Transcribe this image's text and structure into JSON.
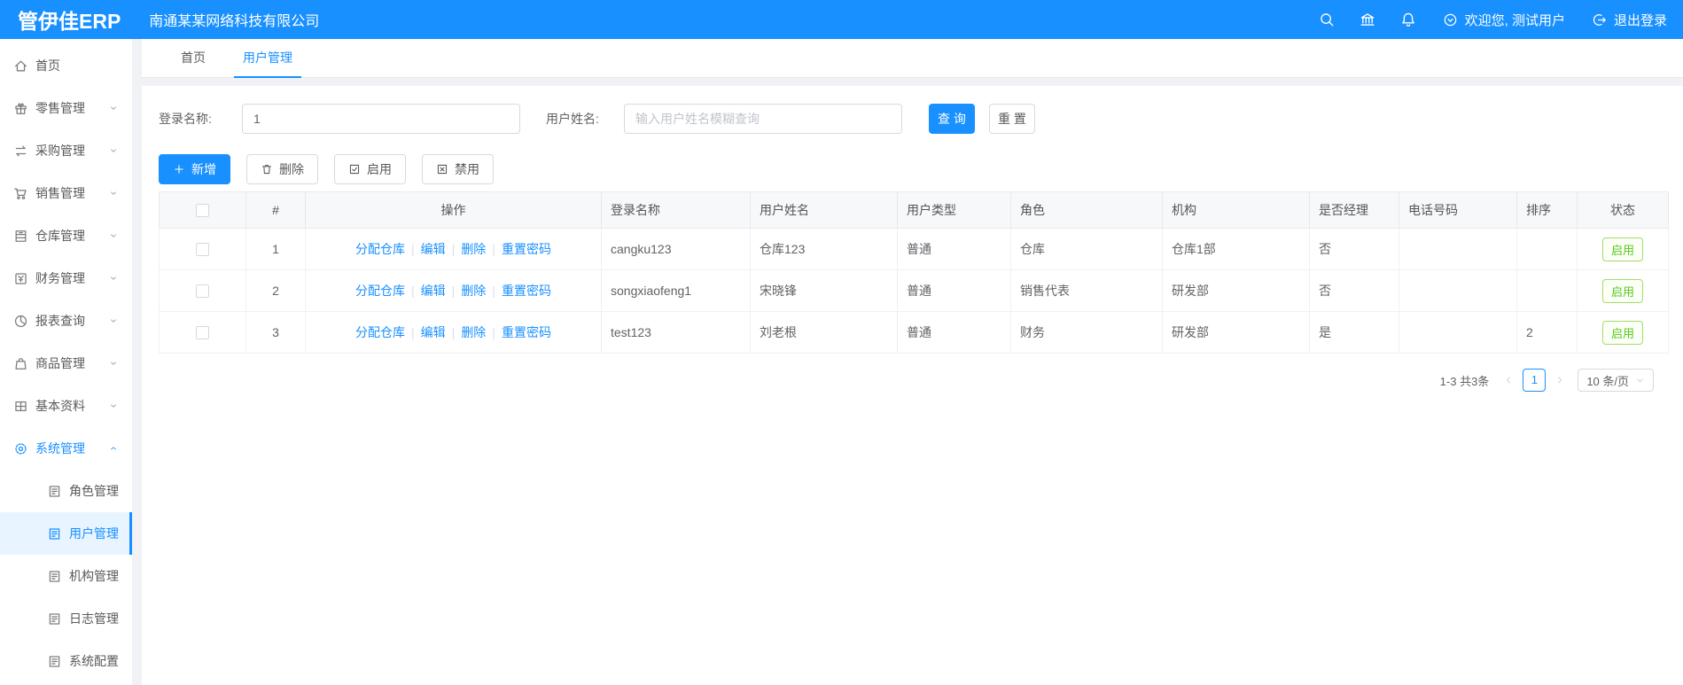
{
  "colors": {
    "accent": "#1890ff",
    "status_green": "#54c71c"
  },
  "header": {
    "logo": "管伊佳ERP",
    "company": "南通某某网络科技有限公司",
    "icon_buttons": [
      {
        "key": "search",
        "icon": "search-icon"
      },
      {
        "key": "bank",
        "icon": "bank-icon"
      },
      {
        "key": "notification",
        "icon": "bell-icon"
      }
    ],
    "welcome": "欢迎您, 测试用户",
    "logout": "退出登录"
  },
  "sidebar": {
    "items": [
      {
        "key": "home",
        "label": "首页",
        "icon": "home-icon",
        "expandable": false
      },
      {
        "key": "retail-management",
        "label": "零售管理",
        "icon": "gift-icon",
        "expandable": true
      },
      {
        "key": "purchase-management",
        "label": "采购管理",
        "icon": "swap-icon",
        "expandable": true
      },
      {
        "key": "sales-management",
        "label": "销售管理",
        "icon": "cart-icon",
        "expandable": true
      },
      {
        "key": "warehouse-management",
        "label": "仓库管理",
        "icon": "storage-icon",
        "expandable": true
      },
      {
        "key": "finance-management",
        "label": "财务管理",
        "icon": "finance-icon",
        "expandable": true
      },
      {
        "key": "report-query",
        "label": "报表查询",
        "icon": "pie-chart-icon",
        "expandable": true
      },
      {
        "key": "product-management",
        "label": "商品管理",
        "icon": "bag-icon",
        "expandable": true
      },
      {
        "key": "basic-data",
        "label": "基本资料",
        "icon": "grid-icon",
        "expandable": true
      },
      {
        "key": "system-management",
        "label": "系统管理",
        "icon": "gear-icon",
        "expandable": true,
        "expanded": true,
        "active": true,
        "children": [
          {
            "key": "role-management",
            "label": "角色管理",
            "icon": "doc-icon"
          },
          {
            "key": "user-management",
            "label": "用户管理",
            "icon": "doc-icon",
            "active": true
          },
          {
            "key": "org-management",
            "label": "机构管理",
            "icon": "doc-icon"
          },
          {
            "key": "log-management",
            "label": "日志管理",
            "icon": "doc-icon"
          },
          {
            "key": "system-config",
            "label": "系统配置",
            "icon": "doc-icon"
          }
        ]
      }
    ]
  },
  "tabs": [
    {
      "key": "home",
      "label": "首页",
      "active": false
    },
    {
      "key": "user-management",
      "label": "用户管理",
      "active": true
    }
  ],
  "search": {
    "login_label": "登录名称:",
    "login_value": "1",
    "name_label": "用户姓名:",
    "name_placeholder": "输入用户姓名模糊查询",
    "query_button": "查 询",
    "reset_button": "重 置"
  },
  "toolbar": {
    "buttons": [
      {
        "key": "add",
        "label": "新增",
        "icon": "plus-icon",
        "primary": true
      },
      {
        "key": "delete",
        "label": "删除",
        "icon": "trash-icon",
        "primary": false
      },
      {
        "key": "enable",
        "label": "启用",
        "icon": "check-square-icon",
        "primary": false
      },
      {
        "key": "disable",
        "label": "禁用",
        "icon": "x-square-icon",
        "primary": false
      }
    ]
  },
  "table": {
    "columns": [
      "#",
      "操作",
      "登录名称",
      "用户姓名",
      "用户类型",
      "角色",
      "机构",
      "是否经理",
      "电话号码",
      "排序",
      "状态"
    ],
    "row_actions": [
      {
        "key": "assign-warehouse",
        "label": "分配仓库"
      },
      {
        "key": "edit",
        "label": "编辑"
      },
      {
        "key": "delete",
        "label": "删除"
      },
      {
        "key": "reset-password",
        "label": "重置密码"
      }
    ],
    "rows": [
      {
        "index": "1",
        "login": "cangku123",
        "name": "仓库123",
        "type": "普通",
        "role": "仓库",
        "org": "仓库1部",
        "manager": "否",
        "phone": "",
        "sort": "",
        "status": "启用"
      },
      {
        "index": "2",
        "login": "songxiaofeng1",
        "name": "宋晓锋",
        "type": "普通",
        "role": "销售代表",
        "org": "研发部",
        "manager": "否",
        "phone": "",
        "sort": "",
        "status": "启用"
      },
      {
        "index": "3",
        "login": "test123",
        "name": "刘老根",
        "type": "普通",
        "role": "财务",
        "org": "研发部",
        "manager": "是",
        "phone": "",
        "sort": "2",
        "status": "启用"
      }
    ]
  },
  "pagination": {
    "total": "1-3 共3条",
    "current_page": "1",
    "page_size": "10 条/页"
  }
}
